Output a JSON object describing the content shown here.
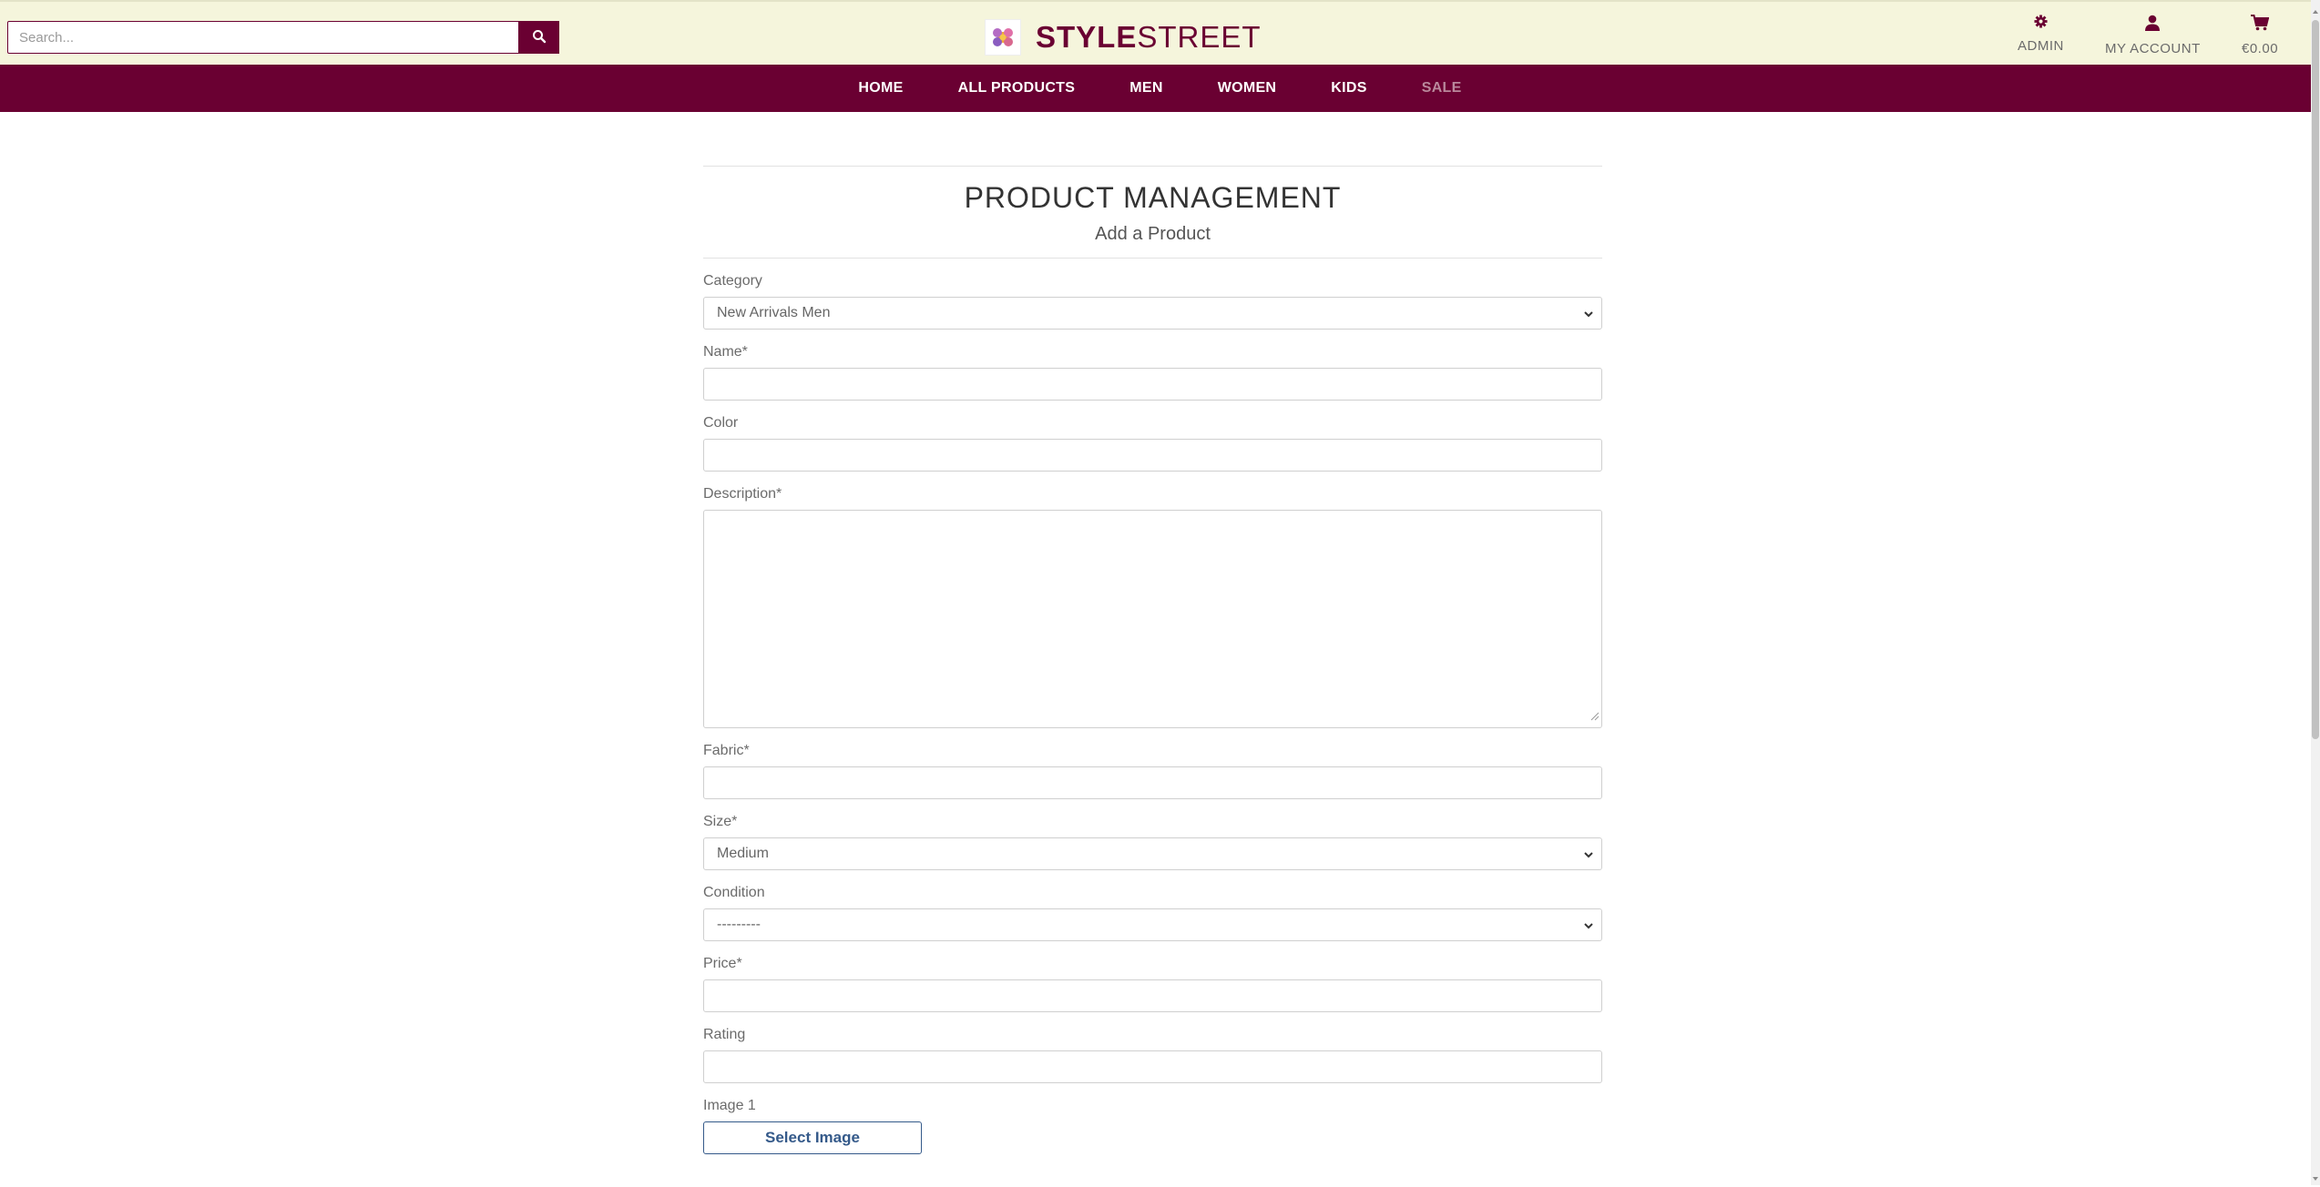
{
  "header": {
    "search_placeholder": "Search...",
    "brand_bold": "STYLE",
    "brand_light": "STREET",
    "admin_label": "ADMIN",
    "account_label": "MY ACCOUNT",
    "cart_total": "€0.00"
  },
  "nav": {
    "items": [
      "HOME",
      "ALL PRODUCTS",
      "MEN",
      "WOMEN",
      "KIDS",
      "SALE"
    ]
  },
  "page": {
    "title": "PRODUCT MANAGEMENT",
    "subtitle": "Add a Product"
  },
  "form": {
    "category_label": "Category",
    "category_value": "New Arrivals Men",
    "name_label": "Name*",
    "name_value": "",
    "color_label": "Color",
    "color_value": "",
    "description_label": "Description*",
    "description_value": "",
    "fabric_label": "Fabric*",
    "fabric_value": "",
    "size_label": "Size*",
    "size_value": "Medium",
    "condition_label": "Condition",
    "condition_value": "---------",
    "price_label": "Price*",
    "price_value": "",
    "rating_label": "Rating",
    "rating_value": "",
    "image1_label": "Image 1",
    "select_image_label": "Select Image"
  },
  "colors": {
    "brand": "#6a0032",
    "topbar_bg": "#f5f5dc",
    "button_outline": "#355a8a"
  },
  "icons": {
    "search": "search-icon",
    "admin": "gear-icon",
    "account": "user-icon",
    "cart": "cart-icon",
    "dropdown": "chevron-down-icon"
  }
}
